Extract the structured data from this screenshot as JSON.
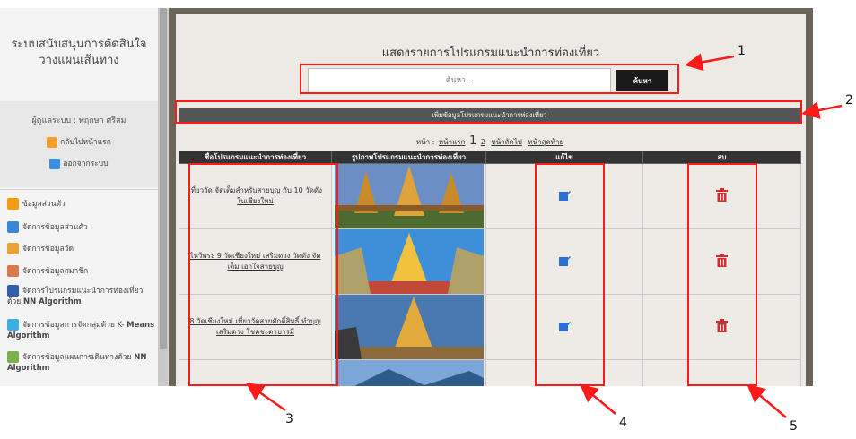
{
  "sidebar": {
    "app_title_line1": "ระบบสนับสนุนการตัดสินใจ",
    "app_title_line2": "วางแผนเส้นทาง",
    "user_label": "ผู้ดูแลระบบ : พฤกษา ศรีสม",
    "home_link": "กลับไปหน้าแรก",
    "logout_link": "ออกจากระบบ",
    "menu": [
      {
        "label": "ข้อมูลส่วนตัว",
        "icon": "profile-icon"
      },
      {
        "label": "จัดการข้อมูลส่วนตัว",
        "icon": "edit-profile-icon"
      },
      {
        "label": "จัดการข้อมูลวัด",
        "icon": "temple-icon"
      },
      {
        "label": "จัดการข้อมูลสมาชิก",
        "icon": "members-icon"
      },
      {
        "label": "จัดการโปรแกรมแนะนำการท่องเที่ยวด้วย",
        "label_bold": "NN Algorithm",
        "icon": "program-icon"
      },
      {
        "label": "จัดการข้อมูลการจัดกลุ่มด้วย K-",
        "label_bold": "Means Algorithm",
        "icon": "cluster-icon"
      },
      {
        "label": "จัดการข้อมูลแผนการเดินทางด้วย",
        "label_bold": "NN Algorithm",
        "icon": "route-plan-icon"
      }
    ]
  },
  "main": {
    "title": "แสดงรายการโปรแกรมแนะนำการท่องเที่ยว",
    "search": {
      "placeholder": "ค้นหา...",
      "button": "ค้นหา"
    },
    "add_button": "เพิ่มข้อมูลโปรแกรมแนะนำการท่องเที่ยว",
    "pagination": {
      "prefix": "หน้า :",
      "first": "หน้าแรก",
      "current": "1",
      "page2": "2",
      "next": "หน้าถัดไป",
      "last": "หน้าสุดท้าย"
    },
    "table": {
      "headers": [
        "ชื่อโปรแกรมแนะนำการท่องเที่ยว",
        "รูปภาพโปรแกรมแนะนำการท่องเที่ยว",
        "แก้ไข",
        "ลบ"
      ],
      "rows": [
        {
          "name": "เที่ยววัด จัดเต็มสำหรับสายบุญ กับ 10 วัดดังในเชียงใหม่"
        },
        {
          "name": "ไหว้พระ 9 วัดเชียงใหม่ เสริมดวง วัดดัง จัดเต็ม เอาใจสายบุญ"
        },
        {
          "name": "8 วัดเชียงใหม่ เที่ยววัดสายศักดิ์สิทธิ์ ทำบุญ เสริมดวง โชคชะตาบารมี"
        },
        {
          "name": ""
        }
      ]
    }
  },
  "annotations": [
    "1",
    "2",
    "3",
    "4",
    "5"
  ],
  "colors": {
    "annotation": "#ff1a1a",
    "header_bg": "#333333",
    "add_bar": "#555555",
    "edit_icon": "#2a6fd6",
    "delete_icon": "#d92b2b"
  }
}
